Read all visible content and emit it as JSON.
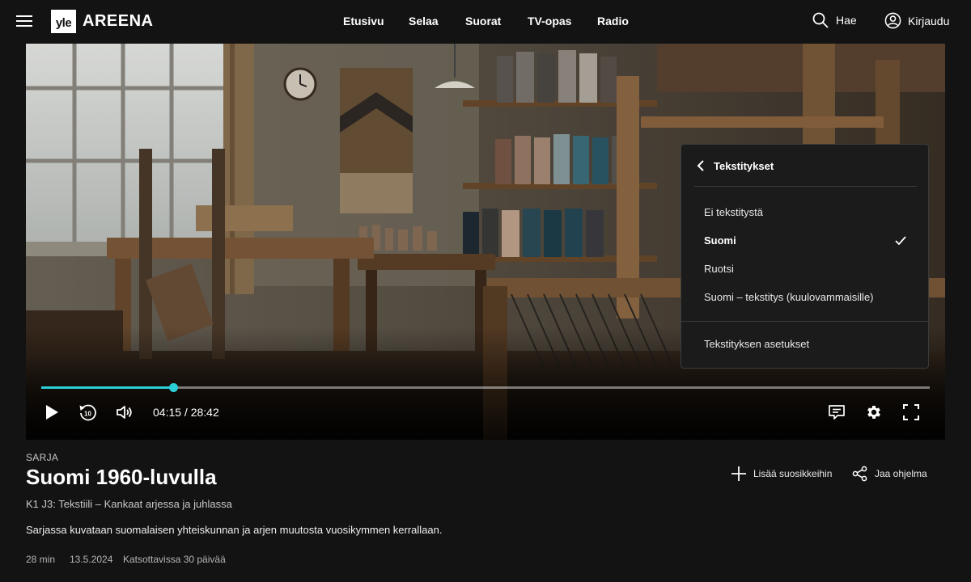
{
  "header": {
    "logo_brand": "yle",
    "logo_text": "AREENA",
    "nav": [
      "Etusivu",
      "Selaa",
      "Suorat",
      "TV-opas",
      "Radio"
    ],
    "search_label": "Hae",
    "login_label": "Kirjaudu"
  },
  "player": {
    "time": "04:15 / 28:42",
    "progress": 0.148,
    "accent_color": "#2ccfd8",
    "controls": {
      "play": "play-icon",
      "rewind": "rewind-10-icon",
      "volume": "volume-icon",
      "subtitles": "subtitles-icon",
      "settings": "gear-icon",
      "fullscreen": "fullscreen-icon"
    },
    "rewind_seconds": "10"
  },
  "subtitle_menu": {
    "title": "Tekstitykset",
    "options": [
      {
        "label": "Ei tekstitystä",
        "selected": false
      },
      {
        "label": "Suomi",
        "selected": true
      },
      {
        "label": "Ruotsi",
        "selected": false
      },
      {
        "label": "Suomi – tekstitys (kuulovammaisille)",
        "selected": false
      }
    ],
    "settings_label": "Tekstityksen asetukset"
  },
  "program": {
    "type": "SARJA",
    "title": "Suomi 1960-luvulla",
    "episode": "K1 J3: Tekstiili – Kankaat arjessa ja juhlassa",
    "description": "Sarjassa kuvataan suomalaisen yhteiskunnan ja arjen muutosta vuosikymmen kerrallaan.",
    "duration": "28 min",
    "date": "13.5.2024",
    "availability": "Katsottavissa 30 päivää",
    "add_favorite_label": "Lisää suosikkeihin",
    "share_label": "Jaa ohjelma"
  }
}
